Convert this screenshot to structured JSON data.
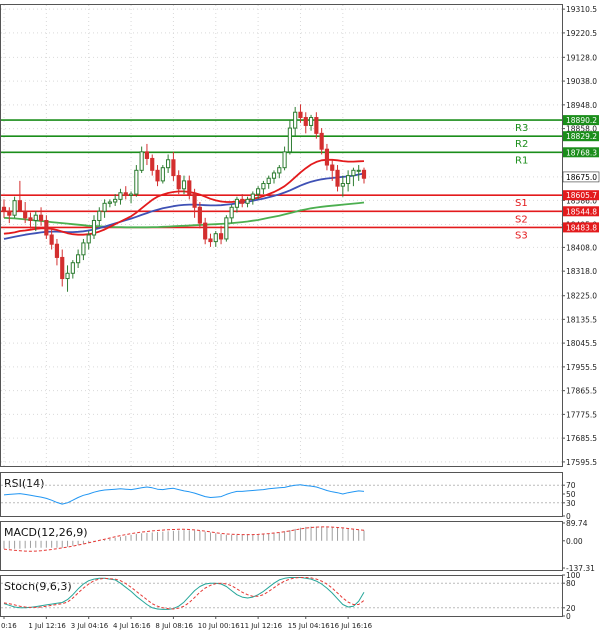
{
  "chart_data": {
    "type": "candlestick",
    "main": {
      "price_ticks": [
        "19310.5",
        "19220.5",
        "19128.0",
        "19038.0",
        "18948.0",
        "18858.0",
        "18768.0",
        "18675.0",
        "18586.0",
        "18495.0",
        "18408.0",
        "18318.0",
        "18225.0",
        "18135.5",
        "18045.5",
        "17955.5",
        "17865.5",
        "17775.5",
        "17685.5",
        "17595.5"
      ],
      "ylim": [
        17580,
        19330
      ],
      "current_price": "18675.0",
      "levels": [
        {
          "name": "R3",
          "price": 18890.2,
          "label": "18890.2",
          "kind": "resistance"
        },
        {
          "name": "R2",
          "price": 18829.2,
          "label": "18829.2",
          "kind": "resistance"
        },
        {
          "name": "R1",
          "price": 18768.3,
          "label": "18768.3",
          "kind": "resistance"
        },
        {
          "name": "S1",
          "price": 18605.7,
          "label": "18605.7",
          "kind": "support"
        },
        {
          "name": "S2",
          "price": 18544.8,
          "label": "18544.8",
          "kind": "support"
        },
        {
          "name": "S3",
          "price": 18483.8,
          "label": "18483.8",
          "kind": "support"
        }
      ],
      "candles": [
        [
          18560,
          18590,
          18520,
          18545
        ],
        [
          18545,
          18560,
          18500,
          18530
        ],
        [
          18530,
          18600,
          18520,
          18585
        ],
        [
          18585,
          18660,
          18560,
          18545
        ],
        [
          18545,
          18580,
          18500,
          18520
        ],
        [
          18520,
          18540,
          18480,
          18510
        ],
        [
          18510,
          18545,
          18470,
          18530
        ],
        [
          18530,
          18560,
          18490,
          18510
        ],
        [
          18510,
          18530,
          18440,
          18455
        ],
        [
          18455,
          18480,
          18400,
          18420
        ],
        [
          18420,
          18440,
          18340,
          18370
        ],
        [
          18370,
          18400,
          18260,
          18290
        ],
        [
          18290,
          18340,
          18240,
          18310
        ],
        [
          18310,
          18360,
          18290,
          18350
        ],
        [
          18350,
          18400,
          18330,
          18380
        ],
        [
          18380,
          18440,
          18360,
          18425
        ],
        [
          18425,
          18470,
          18400,
          18455
        ],
        [
          18455,
          18530,
          18440,
          18510
        ],
        [
          18510,
          18560,
          18490,
          18545
        ],
        [
          18545,
          18590,
          18520,
          18575
        ],
        [
          18575,
          18590,
          18560,
          18580
        ],
        [
          18580,
          18610,
          18565,
          18590
        ],
        [
          18590,
          18630,
          18570,
          18615
        ],
        [
          18615,
          18640,
          18590,
          18605
        ],
        [
          18605,
          18620,
          18575,
          18610
        ],
        [
          18610,
          18720,
          18600,
          18700
        ],
        [
          18700,
          18790,
          18690,
          18770
        ],
        [
          18770,
          18800,
          18720,
          18745
        ],
        [
          18745,
          18760,
          18680,
          18700
        ],
        [
          18700,
          18720,
          18640,
          18660
        ],
        [
          18660,
          18720,
          18650,
          18710
        ],
        [
          18710,
          18760,
          18690,
          18740
        ],
        [
          18740,
          18770,
          18660,
          18680
        ],
        [
          18680,
          18700,
          18610,
          18630
        ],
        [
          18630,
          18680,
          18610,
          18660
        ],
        [
          18660,
          18680,
          18590,
          18610
        ],
        [
          18610,
          18630,
          18520,
          18560
        ],
        [
          18560,
          18580,
          18480,
          18500
        ],
        [
          18500,
          18520,
          18420,
          18440
        ],
        [
          18440,
          18460,
          18410,
          18430
        ],
        [
          18430,
          18470,
          18410,
          18460
        ],
        [
          18460,
          18490,
          18420,
          18440
        ],
        [
          18440,
          18530,
          18430,
          18520
        ],
        [
          18520,
          18570,
          18500,
          18560
        ],
        [
          18560,
          18600,
          18540,
          18590
        ],
        [
          18590,
          18610,
          18560,
          18575
        ],
        [
          18575,
          18600,
          18560,
          18590
        ],
        [
          18590,
          18620,
          18570,
          18610
        ],
        [
          18610,
          18640,
          18590,
          18630
        ],
        [
          18630,
          18660,
          18610,
          18650
        ],
        [
          18650,
          18680,
          18630,
          18670
        ],
        [
          18670,
          18700,
          18650,
          18690
        ],
        [
          18690,
          18720,
          18670,
          18710
        ],
        [
          18710,
          18790,
          18700,
          18770
        ],
        [
          18770,
          18890,
          18760,
          18860
        ],
        [
          18860,
          18940,
          18830,
          18920
        ],
        [
          18920,
          18950,
          18880,
          18900
        ],
        [
          18900,
          18920,
          18840,
          18870
        ],
        [
          18870,
          18910,
          18850,
          18900
        ],
        [
          18900,
          18920,
          18820,
          18840
        ],
        [
          18840,
          18860,
          18760,
          18780
        ],
        [
          18780,
          18800,
          18700,
          18720
        ],
        [
          18720,
          18740,
          18660,
          18700
        ],
        [
          18700,
          18720,
          18620,
          18640
        ],
        [
          18640,
          18680,
          18600,
          18650
        ],
        [
          18650,
          18700,
          18620,
          18680
        ],
        [
          18680,
          18710,
          18640,
          18700
        ],
        [
          18700,
          18720,
          18660,
          18700
        ],
        [
          18700,
          18710,
          18650,
          18670
        ]
      ],
      "ma_fast": [
        18460,
        18462,
        18465,
        18470,
        18472,
        18475,
        18478,
        18480,
        18480,
        18478,
        18474,
        18468,
        18462,
        18458,
        18456,
        18456,
        18458,
        18462,
        18468,
        18476,
        18486,
        18496,
        18506,
        18516,
        18526,
        18540,
        18556,
        18572,
        18588,
        18600,
        18608,
        18614,
        18618,
        18620,
        18620,
        18618,
        18614,
        18608,
        18600,
        18592,
        18586,
        18582,
        18580,
        18580,
        18582,
        18584,
        18588,
        18592,
        18596,
        18602,
        18610,
        18618,
        18628,
        18640,
        18656,
        18674,
        18692,
        18708,
        18722,
        18732,
        18738,
        18740,
        18740,
        18738,
        18735,
        18733,
        18733,
        18734,
        18735
      ],
      "ma_mid": [
        18440,
        18444,
        18448,
        18452,
        18456,
        18459,
        18462,
        18465,
        18467,
        18468,
        18468,
        18467,
        18466,
        18466,
        18467,
        18469,
        18472,
        18476,
        18481,
        18487,
        18493,
        18499,
        18505,
        18511,
        18517,
        18524,
        18531,
        18538,
        18545,
        18551,
        18556,
        18560,
        18564,
        18567,
        18569,
        18570,
        18570,
        18569,
        18568,
        18567,
        18567,
        18568,
        18570,
        18572,
        18575,
        18578,
        18581,
        18585,
        18589,
        18593,
        18598,
        18603,
        18609,
        18616,
        18624,
        18633,
        18642,
        18650,
        18657,
        18662,
        18666,
        18669,
        18671,
        18673,
        18675,
        18677,
        18680,
        18684,
        18688
      ],
      "ma_slow": [
        18520,
        18519,
        18518,
        18516,
        18514,
        18512,
        18510,
        18508,
        18506,
        18504,
        18502,
        18500,
        18498,
        18496,
        18494,
        18492,
        18490,
        18489,
        18488,
        18487,
        18486,
        18485,
        18485,
        18484,
        18484,
        18484,
        18484,
        18484,
        18485,
        18485,
        18486,
        18487,
        18488,
        18489,
        18490,
        18491,
        18492,
        18493,
        18494,
        18495,
        18496,
        18497,
        18498,
        18500,
        18502,
        18504,
        18506,
        18509,
        18512,
        18516,
        18520,
        18524,
        18528,
        18533,
        18538,
        18543,
        18548,
        18552,
        18556,
        18559,
        18562,
        18564,
        18566,
        18568,
        18570,
        18572,
        18574,
        18576,
        18578
      ]
    },
    "x_labels": [
      "0:16",
      "1 Jul 12:16",
      "3 Jul 04:16",
      "4 Jul 16:16",
      "8 Jul 08:16",
      "10 Jul 00:16",
      "11 Jul 12:16",
      "15 Jul 04:16",
      "16 Jul 16:16"
    ],
    "rsi": {
      "label": "RSI(14)",
      "ticks": [
        "70",
        "50",
        "30",
        "0"
      ],
      "ylim": [
        0,
        100
      ],
      "values": [
        48,
        49,
        50,
        51,
        49,
        47,
        45,
        43,
        40,
        36,
        31,
        27,
        30,
        36,
        42,
        47,
        50,
        54,
        57,
        59,
        60,
        61,
        62,
        61,
        60,
        62,
        64,
        66,
        64,
        61,
        60,
        62,
        63,
        60,
        57,
        55,
        52,
        48,
        44,
        42,
        43,
        44,
        49,
        53,
        56,
        56,
        57,
        58,
        59,
        60,
        62,
        63,
        64,
        65,
        68,
        70,
        71,
        69,
        68,
        66,
        62,
        58,
        55,
        53,
        50,
        53,
        55,
        57,
        56
      ]
    },
    "macd": {
      "label": "MACD(12,26,9)",
      "ticks": [
        "89.74",
        "0.00",
        "-137.31"
      ],
      "ylim": [
        -137.31,
        89.74
      ],
      "hist": [
        -40,
        -40,
        -40,
        -40,
        -38,
        -36,
        -35,
        -35,
        -35,
        -35,
        -35,
        -35,
        -30,
        -25,
        -20,
        -15,
        -10,
        -5,
        0,
        5,
        10,
        15,
        20,
        25,
        30,
        35,
        38,
        40,
        42,
        44,
        46,
        48,
        50,
        52,
        54,
        53,
        52,
        50,
        46,
        42,
        38,
        34,
        30,
        30,
        30,
        30,
        30,
        30,
        30,
        32,
        35,
        38,
        42,
        48,
        54,
        60,
        66,
        70,
        72,
        72,
        72,
        70,
        68,
        66,
        64,
        60,
        57,
        54,
        52
      ],
      "signal": [
        -42,
        -45,
        -48,
        -50,
        -52,
        -53,
        -52,
        -50,
        -47,
        -44,
        -40,
        -36,
        -32,
        -27,
        -22,
        -16,
        -10,
        -4,
        2,
        8,
        14,
        20,
        26,
        31,
        36,
        40,
        44,
        47,
        50,
        52,
        54,
        56,
        57,
        58,
        58,
        57,
        55,
        52,
        49,
        45,
        41,
        37,
        34,
        33,
        32,
        31,
        31,
        31,
        32,
        34,
        36,
        39,
        42,
        46,
        50,
        55,
        60,
        64,
        67,
        69,
        70,
        70,
        69,
        67,
        65,
        62,
        59,
        56,
        53
      ]
    },
    "stoch": {
      "label": "Stoch(9,6,3)",
      "ticks": [
        "100",
        "80",
        "20",
        "0"
      ],
      "ylim": [
        0,
        100
      ],
      "k": [
        30,
        26,
        22,
        20,
        20,
        21,
        23,
        25,
        27,
        29,
        31,
        33,
        40,
        52,
        66,
        78,
        86,
        90,
        92,
        92,
        90,
        88,
        80,
        70,
        60,
        48,
        38,
        28,
        20,
        17,
        16,
        16,
        18,
        24,
        34,
        48,
        62,
        72,
        78,
        80,
        80,
        78,
        72,
        62,
        52,
        46,
        44,
        46,
        52,
        60,
        70,
        80,
        88,
        92,
        94,
        94,
        94,
        92,
        90,
        85,
        78,
        68,
        56,
        42,
        28,
        22,
        24,
        36,
        58
      ],
      "d": [
        32,
        30,
        27,
        24,
        22,
        21,
        21,
        22,
        24,
        26,
        28,
        30,
        34,
        44,
        56,
        68,
        78,
        86,
        90,
        92,
        91,
        90,
        86,
        79,
        70,
        60,
        50,
        40,
        30,
        24,
        20,
        18,
        17,
        19,
        24,
        33,
        45,
        58,
        68,
        75,
        79,
        80,
        78,
        74,
        66,
        58,
        52,
        48,
        48,
        52,
        60,
        69,
        78,
        85,
        90,
        93,
        94,
        94,
        93,
        90,
        85,
        78,
        68,
        56,
        44,
        34,
        28,
        28,
        38
      ]
    },
    "colors": {
      "bull": "#2e7d32",
      "bear": "#d32f2f",
      "ma_fast": "#e31a1c",
      "ma_mid": "#3f51b5",
      "ma_slow": "#4caf50",
      "resistance": "#1b8e1b",
      "support": "#e31a1c",
      "current": "#ffffff",
      "osc_line": "#2196f3",
      "macd_signal": "#e53935",
      "macd_hist": "#9e9e9e",
      "stoch_k": "#26a69a",
      "stoch_d": "#e53935",
      "grid": "#d9d9d9"
    }
  }
}
